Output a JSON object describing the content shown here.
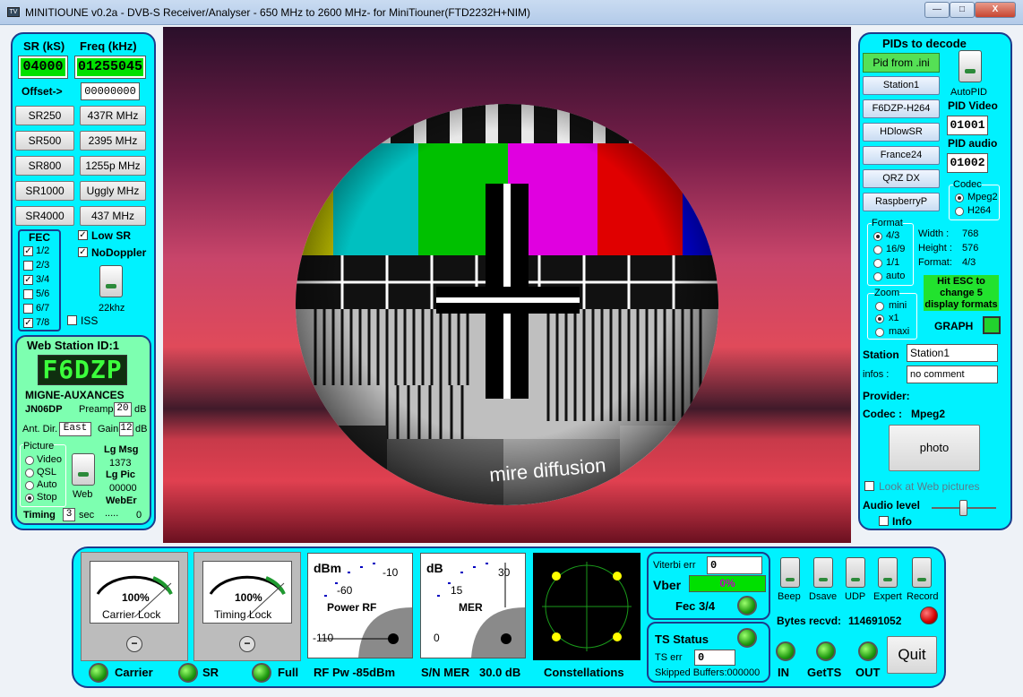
{
  "window": {
    "title": "MINITIOUNE v0.2a - DVB-S Receiver/Analyser - 650 MHz to 2600 MHz- for MiniTiouner(FTD2232H+NIM)",
    "min": "—",
    "max": "□",
    "close": "X"
  },
  "tuning": {
    "sr_label": "SR (kS)",
    "freq_label": "Freq (kHz)",
    "sr_value": "04000",
    "freq_value": "01255045",
    "offset_label": "Offset->",
    "offset_value": "00000000",
    "sr_buttons": [
      "SR250",
      "SR500",
      "SR800",
      "SR1000",
      "SR4000"
    ],
    "freq_buttons": [
      "437R MHz",
      "2395 MHz",
      "1255p MHz",
      "Uggly MHz",
      "437 MHz"
    ]
  },
  "fec": {
    "label": "FEC",
    "items": [
      {
        "label": "1/2",
        "checked": true
      },
      {
        "label": "2/3",
        "checked": false
      },
      {
        "label": "3/4",
        "checked": true
      },
      {
        "label": "5/6",
        "checked": false
      },
      {
        "label": "6/7",
        "checked": false
      },
      {
        "label": "7/8",
        "checked": true
      }
    ],
    "low_sr": "Low SR",
    "no_doppler": "NoDoppler",
    "iss": "ISS",
    "switch_label": "22khz"
  },
  "web_station": {
    "title": "Web Station ID:1",
    "callsign": "F6DZP",
    "location": "MIGNE-AUXANCES",
    "locator": "JN06DP",
    "preamp_label": "Preamp",
    "preamp_value": "20",
    "preamp_unit": "dB",
    "ant_label": "Ant. Dir.",
    "ant_value": "East",
    "gain_label": "Gain",
    "gain_value": "12",
    "gain_unit": "dB",
    "picture_label": "Picture",
    "picture_options": [
      "Video",
      "QSL",
      "Auto",
      "Stop"
    ],
    "picture_selected": "Stop",
    "web_label": "Web",
    "lg_msg_label": "Lg Msg",
    "lg_msg_value": "1373",
    "lg_pic_label": "Lg Pic",
    "lg_pic_value": "00000",
    "weber_label": "WebEr",
    "weber_value": "0",
    "timing_label": "Timing",
    "timing_value": "3",
    "timing_unit": "sec",
    "dots": "....."
  },
  "video": {
    "caption": "mire diffusion"
  },
  "pids": {
    "title": "PIDs to decode",
    "pid_from_ini": "Pid from .ini",
    "stations": [
      "Station1",
      "F6DZP-H264",
      "HDlowSR",
      "France24",
      "QRZ DX",
      "RaspberryP"
    ],
    "autopid": "AutoPID",
    "pid_video_label": "PID Video",
    "pid_video": "01001",
    "pid_audio_label": "PID audio",
    "pid_audio": "01002",
    "codec_label": "Codec",
    "codec_options": [
      "Mpeg2",
      "H264"
    ],
    "codec_selected": "Mpeg2",
    "format_label": "Format",
    "format_options": [
      "4/3",
      "16/9",
      "1/1",
      "auto"
    ],
    "format_selected": "4/3",
    "width_label": "Width :",
    "width_value": "768",
    "height_label": "Height :",
    "height_value": "576",
    "fmt_label": "Format:",
    "fmt_value": "4/3",
    "esc_hint": "Hit ESC to change 5 display formats",
    "zoom_label": "Zoom",
    "zoom_options": [
      "mini",
      "x1",
      "maxi"
    ],
    "zoom_selected": "x1",
    "graph_label": "GRAPH",
    "station_label": "Station",
    "station_value": "Station1",
    "infos_label": "infos :",
    "infos_value": "no comment",
    "provider_label": "Provider:",
    "codec_info_label": "Codec :",
    "codec_info_value": "Mpeg2",
    "photo": "photo",
    "look_web": "Look at Web pictures",
    "audio_label": "Audio level",
    "info_label": "Info"
  },
  "status": {
    "carrier_pct": "100%",
    "carrier_label": "Carrier Lock",
    "timing_pct": "100%",
    "timing_label": "Timing Lock",
    "rf": {
      "unit": "dBm",
      "t1": "-10",
      "t2": "-60",
      "t3": "-110",
      "label": "Power RF"
    },
    "mer": {
      "unit": "dB",
      "t1": "30",
      "t2": "15",
      "t3": "0",
      "label": "MER"
    },
    "leds": [
      "Carrier",
      "SR",
      "Full"
    ],
    "rf_pw": "RF Pw -85dBm",
    "sn_mer": "S/N MER   30.0 dB",
    "constellations": "Constellations",
    "viterbi_label": "Viterbi err",
    "viterbi_value": "0",
    "vber_label": "Vber",
    "vber_value": "0%",
    "fec_label": "Fec 3/4",
    "ts_status": "TS Status",
    "ts_err_label": "TS err",
    "ts_err_value": "0",
    "skipped": "Skipped Buffers:000000",
    "switches": [
      "Beep",
      "Dsave",
      "UDP",
      "Expert",
      "Record"
    ],
    "bytes_label": "Bytes recvd:",
    "bytes_value": "114691052",
    "bottom_leds": [
      "IN",
      "GetTS",
      "OUT"
    ],
    "quit": "Quit"
  }
}
